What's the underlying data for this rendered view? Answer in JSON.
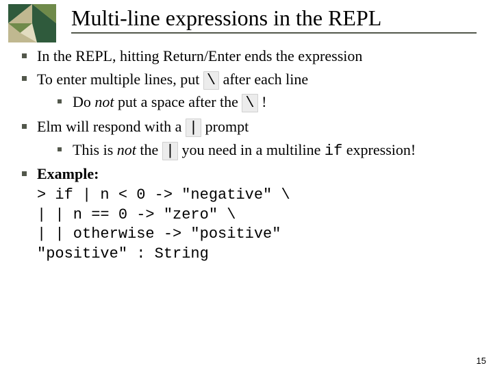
{
  "slide": {
    "title": "Multi-line expressions in the REPL",
    "page_number": "15"
  },
  "bullets": {
    "b1": {
      "text": "In the REPL, hitting Return/Enter ends the expression"
    },
    "b2": {
      "pre": "To enter multiple lines, put ",
      "code": "\\",
      "post": " after each line",
      "sub": {
        "pre": "Do ",
        "em": "not",
        "mid": " put a space after the ",
        "code": "\\",
        "post": " !"
      }
    },
    "b3": {
      "pre": "Elm will respond with a ",
      "code": "|",
      "post": " prompt",
      "sub": {
        "pre": "This is ",
        "em": "not",
        "mid": " the ",
        "code": "|",
        "mid2": " you need in a multiline ",
        "code2": "if",
        "post": " expression!"
      }
    },
    "b4": {
      "label": "Example:",
      "code_lines": {
        "l1": "> if | n < 0 -> \"negative\" \\",
        "l2": "| | n == 0 -> \"zero\" \\",
        "l3": "| | otherwise -> \"positive\"",
        "l4": "\"positive\" : String"
      }
    }
  }
}
